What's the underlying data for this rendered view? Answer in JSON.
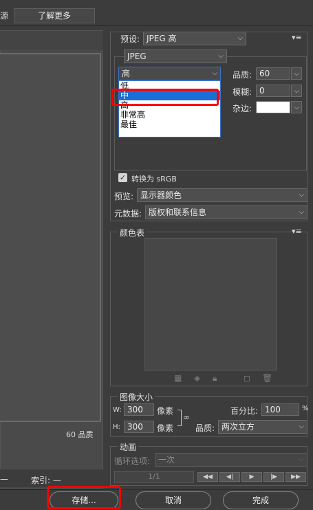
{
  "top": {
    "source_tab": "源",
    "learn_more": "了解更多"
  },
  "preview_footer": {
    "quality": "60 品质",
    "dash": "—",
    "index": "索引: —"
  },
  "preset": {
    "label": "预设:",
    "value": "JPEG 高"
  },
  "format": {
    "value": "JPEG"
  },
  "quality_dropdown": {
    "value": "高",
    "options": [
      "低",
      "中",
      "高",
      "非常高",
      "最佳"
    ],
    "selected_index": 1
  },
  "quality": {
    "label": "品质:",
    "value": "60"
  },
  "blur": {
    "label": "模糊:",
    "value": "0"
  },
  "matte": {
    "label": "杂边:",
    "color": "#ffffff"
  },
  "convert_srgb": {
    "label": "转换为 sRGB",
    "checked": true
  },
  "preview": {
    "label": "预览:",
    "value": "显示器颜色"
  },
  "metadata": {
    "label": "元数据:",
    "value": "版权和联系信息"
  },
  "color_table": {
    "title": "颜色表"
  },
  "image_size": {
    "title": "图像大小",
    "w_label": "W:",
    "w_value": "300",
    "w_unit": "像素",
    "h_label": "H:",
    "h_value": "300",
    "h_unit": "像素",
    "percent_label": "百分比:",
    "percent_value": "100",
    "percent_unit": "%",
    "quality_label": "品质:",
    "quality_value": "两次立方"
  },
  "animation": {
    "title": "动画",
    "loop_label": "循环选项:",
    "loop_value": "一次",
    "frame": "1/1",
    "controls": [
      "◀◀",
      "◀|",
      "▶",
      "|▶",
      "▶▶"
    ]
  },
  "buttons": {
    "save": "存储...",
    "cancel": "取消",
    "done": "完成"
  },
  "colors": {
    "highlight": "#ff0000",
    "selection": "#1a6ed6"
  }
}
